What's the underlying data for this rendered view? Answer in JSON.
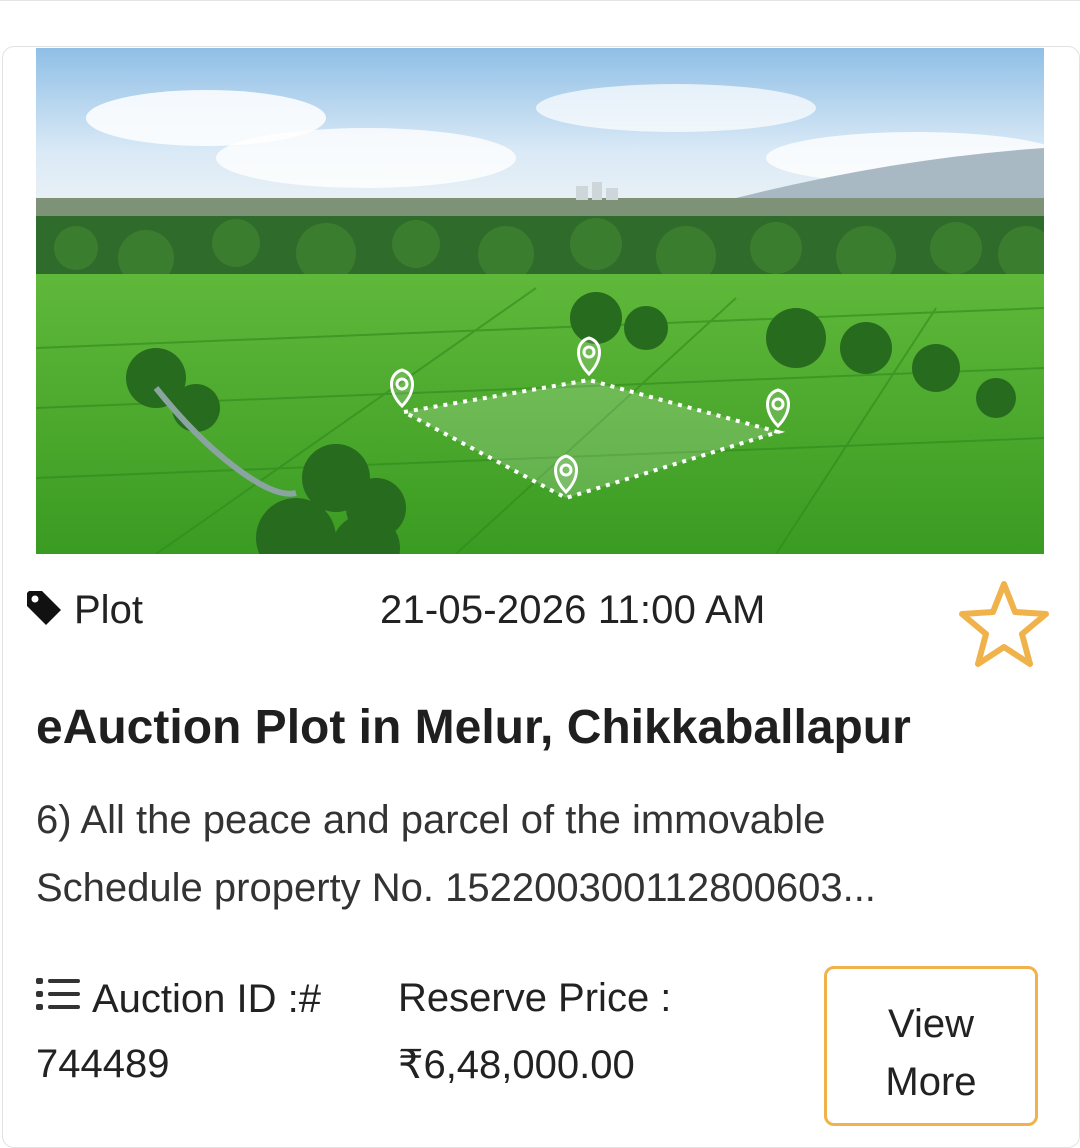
{
  "listing": {
    "category": "Plot",
    "date_time": "21-05-2026 11:00 AM",
    "title": "eAuction Plot in Melur, Chikkaballapur",
    "description_line1": "6) All the peace and parcel of the immovable",
    "description_line2": "Schedule property No. 152200300112800603...",
    "auction_id_label": "Auction ID :#",
    "auction_id_value": "744489",
    "reserve_price_label": "Reserve Price :",
    "reserve_price_value": "₹6,48,000.00",
    "view_more_line1": "View",
    "view_more_line2": "More",
    "image_alt": "Aerial view of green farmland with a marked plot"
  },
  "icons": {
    "category": "tag-icon",
    "favorite": "star-outline-icon",
    "auction_id": "list-icon",
    "location_markers": "map-pin-icon"
  },
  "colors": {
    "accent": "#f0b24a",
    "text": "#222222",
    "border": "#e2e2e2"
  }
}
